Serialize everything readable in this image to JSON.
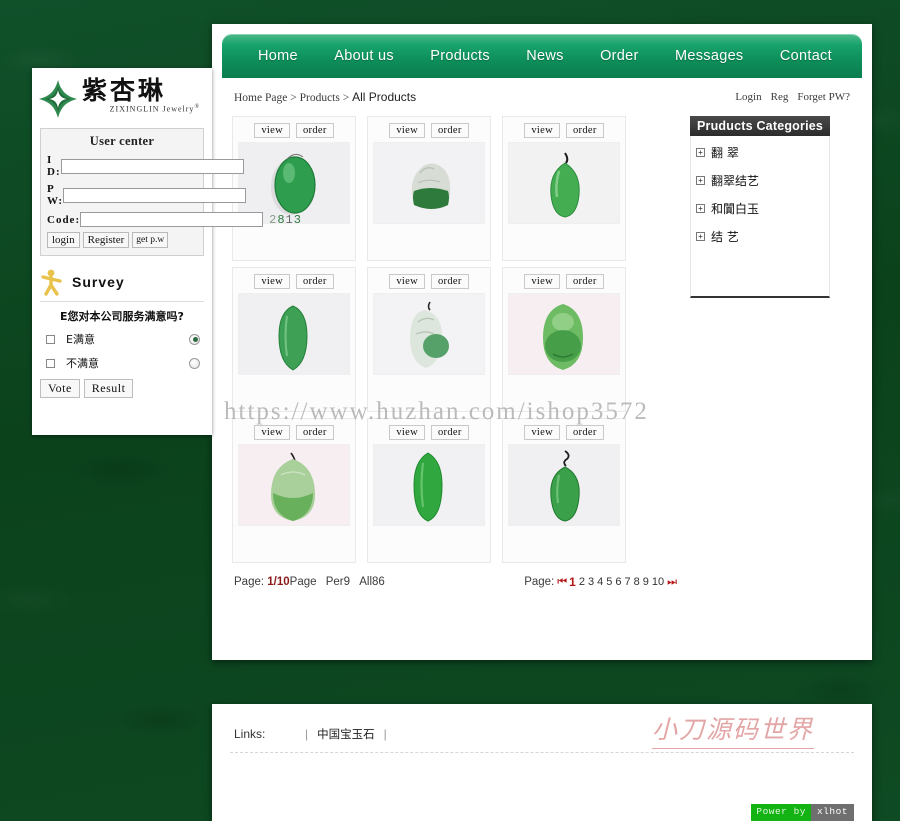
{
  "site": {
    "background_color": "#0d4a21",
    "nav_accent": "#0d8d59"
  },
  "logo": {
    "cn_name": "紫杏琳",
    "latin": "ZIXINGLIN",
    "jewelry": "Jewelry",
    "reg_mark": "®"
  },
  "user_center": {
    "title": "User center",
    "id_label": "I  D:",
    "pw_label": "P  W:",
    "code_label": "Code:",
    "id_value": "",
    "pw_value": "",
    "code_value": "",
    "captcha": "2813",
    "login_label": "login",
    "register_label": "Register",
    "getpw_label": "get p.w"
  },
  "survey": {
    "title": "Survey",
    "icon": "person-icon",
    "question": "E您对本公司服务满意吗?",
    "options": [
      {
        "label": "E满意",
        "selected": true
      },
      {
        "label": "不满意",
        "selected": false
      }
    ],
    "vote_label": "Vote",
    "result_label": "Result"
  },
  "nav": {
    "items": [
      {
        "label": "Home",
        "active": true
      },
      {
        "label": "About us",
        "active": false
      },
      {
        "label": "Products",
        "active": false
      },
      {
        "label": "News",
        "active": false
      },
      {
        "label": "Order",
        "active": false
      },
      {
        "label": "Messages",
        "active": false
      },
      {
        "label": "Contact",
        "active": false
      }
    ]
  },
  "breadcrumb": {
    "root": "Home Page",
    "sep1": ">",
    "level2": "Products",
    "sep2": ">",
    "current": "All Products"
  },
  "auth_links": [
    {
      "label": "Login"
    },
    {
      "label": "Reg"
    },
    {
      "label": "Forget PW?"
    }
  ],
  "products": {
    "view_label": "view",
    "order_label": "order",
    "items": [
      {
        "name": "jade-pendant-1",
        "shape": "oval",
        "body": "#2e9e4e",
        "body2": "#1d7a38",
        "bg": "#efeef0"
      },
      {
        "name": "jade-pendant-2",
        "shape": "carved",
        "body": "#cfd6cd",
        "body2": "#2d7a3c",
        "bg": "#f2f1f3"
      },
      {
        "name": "jade-pendant-3",
        "shape": "teardrop",
        "body": "#44ad52",
        "body2": "#2a8a3b",
        "bg": "#f3f2f2"
      },
      {
        "name": "jade-pendant-4",
        "shape": "long",
        "body": "#3da055",
        "body2": "#24813b",
        "bg": "#f0eff1"
      },
      {
        "name": "jade-pendant-5",
        "shape": "carved",
        "body": "#dde6dc",
        "body2": "#56a169",
        "bg": "#f3f2f4"
      },
      {
        "name": "jade-pendant-6",
        "shape": "buddha",
        "body": "#6dbb63",
        "body2": "#36913f",
        "bg": "#f7eef2"
      },
      {
        "name": "jade-pendant-7",
        "shape": "buddha",
        "body": "#a9cf9a",
        "body2": "#68b05c",
        "bg": "#f6eef1"
      },
      {
        "name": "jade-pendant-8",
        "shape": "long",
        "body": "#31a73f",
        "body2": "#1d8a2c",
        "bg": "#f1f0f2"
      },
      {
        "name": "jade-pendant-9",
        "shape": "oval",
        "body": "#3aa049",
        "body2": "#217a31",
        "bg": "#f0eff1"
      }
    ]
  },
  "pager": {
    "left_label": "Page:",
    "current_page": "1/10",
    "page_word": "Page",
    "per_label": "Per9",
    "all_label": "All86",
    "right_label": "Page:",
    "first_arrow": "⏮",
    "last_arrow": "⏭",
    "numbers": [
      "1",
      "2",
      "3",
      "4",
      "5",
      "6",
      "7",
      "8",
      "9",
      "10"
    ],
    "active_number": "1"
  },
  "categories": {
    "title": "Pruducts Categories",
    "items": [
      {
        "label": "翻 翠",
        "expander": "+"
      },
      {
        "label": "翻翠结艺",
        "expander": "+"
      },
      {
        "label": "和闐白玉",
        "expander": "+"
      },
      {
        "label": "结 艺",
        "expander": "+"
      }
    ]
  },
  "watermark": {
    "main": "https://www.huzhan.com/ishop3572",
    "footer": "小刀源码世界"
  },
  "footer": {
    "links_label": "Links:",
    "bar": "|",
    "link_text": "中国宝玉石",
    "power_by": "Power by",
    "power_name": "xlhot"
  }
}
